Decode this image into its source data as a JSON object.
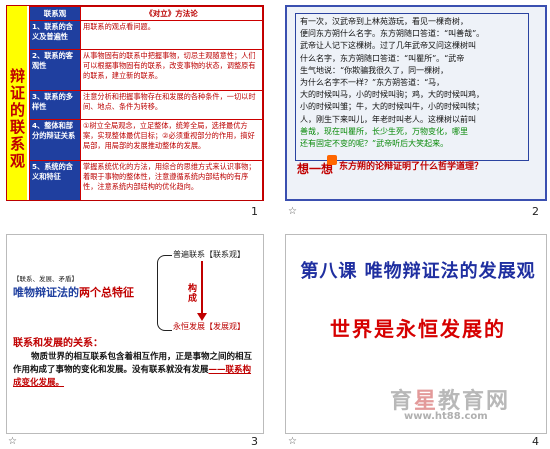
{
  "slide1": {
    "number": "1",
    "sidebar": "辩证的联系观",
    "headers": [
      "联系观",
      "《对立》方法论"
    ],
    "rows": [
      {
        "label": "1、联系的含义及普遍性",
        "content": "用联系的观点看问题。"
      },
      {
        "label": "2、联系的客观性",
        "content": "从事物固有的联系中把握事物，切忌主观随意性；人们可以根据事物固有的联系，改变事物的状态，调整原有的联系，建立新的联系。"
      },
      {
        "label": "3、联系的多样性",
        "content": "注意分析和把握事物存在和发展的各种条件，一切以时间、地点、条件为转移。"
      },
      {
        "label": "4、整体和部分的辩证关系",
        "content": "①树立全局观念，立足整体，统筹全局，选择最优方案，实现整体最优目标；②必须重视部分的作用，搞好局部，用局部的发展推动整体的发展。"
      },
      {
        "label": "5、系统的含义和特征",
        "content": "掌握系统优化的方法，用综合的思维方式来认识事物；着眼于事物的整体性，注意遵循系统内部结构的有序性，注意系统内部结构的优化趋向。"
      }
    ]
  },
  "slide2": {
    "number": "2",
    "star": "☆",
    "story_lines": [
      "有一次，汉武帝到上林苑游玩，看见一棵奇树，",
      "便问东方朔什么名字。东方朔随口答道：“叫善哉”。",
      "武帝让人记下这棵树。过了几年武帝又问这棵树叫",
      "什么名字，东方朔随口答道：“叫瞿所”。“武帝",
      "生气地说：“你欺骗我很久了，同一棵树，",
      "为什么名字不一样？”东方朔答道：“马，",
      "大的时候叫马，小的时候叫驹；鸡，大的时候叫鸡，",
      "小的时候叫雏；牛，大的时候叫牛，小的时候叫犊；",
      "人，刚生下来叫儿，年老时叫老人。这棵树以前叫",
      "善哉，现在叫瞿所，长少生死，万物变化，哪里",
      "还有固定不变的呢？”武帝听后大笑起来。"
    ],
    "think_label": "想一想",
    "question": "东方朔的论辩证明了什么哲学道理？"
  },
  "slide3": {
    "number": "3",
    "star": "☆",
    "tag": "【联系、发展、矛盾】",
    "title_prefix": "唯物辩证法的",
    "title_suffix": "两个总特征",
    "upper": "普遍联系【联系观】",
    "lower": "永恒发展【发展观】",
    "arrow_label": "构成",
    "relation_title": "联系和发展的关系：",
    "para_a": "物质世界的相互联系包含着相互作用，正是事物之间的相互作用构成了事物的变化和发展。没有联系就没有发展",
    "para_b": "——联系构成变化发展。"
  },
  "slide4": {
    "number": "4",
    "star": "☆",
    "title1": "第八课 唯物辩证法的发展观",
    "title2": "世界是永恒发展的",
    "watermark_a": "育",
    "watermark_b": "星",
    "watermark_c": "教育网",
    "watermark_url": "www.ht88.com"
  }
}
